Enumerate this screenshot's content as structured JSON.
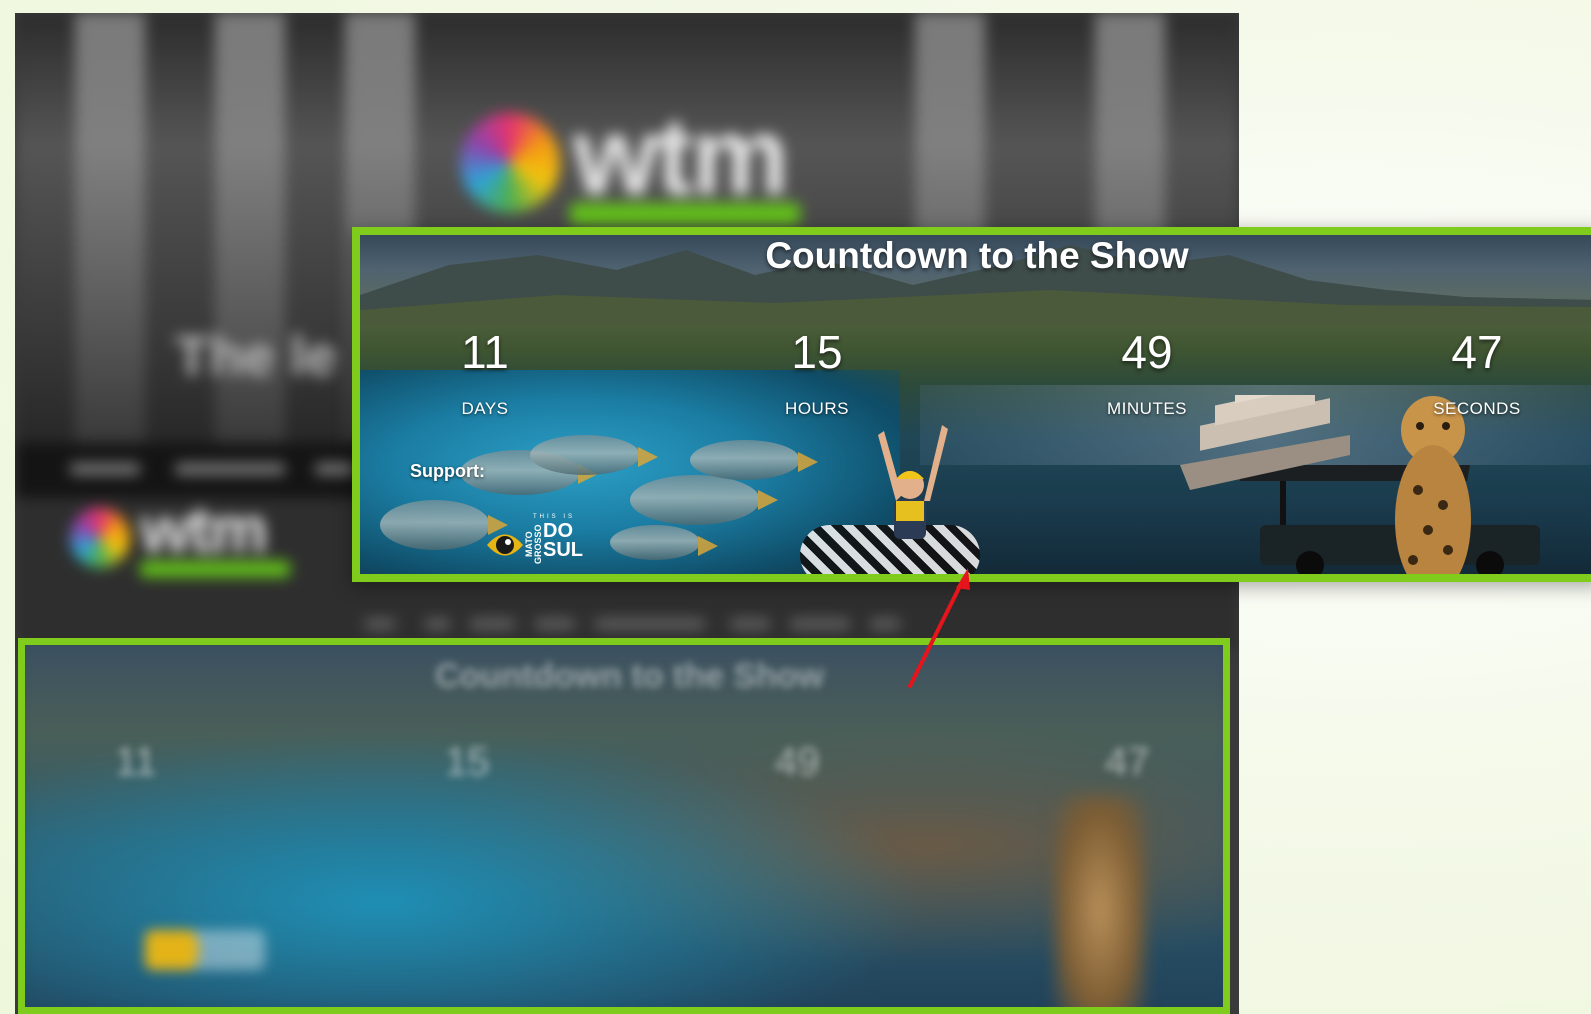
{
  "background_site": {
    "logo_text": "wtm",
    "tagline_fragment": "The le"
  },
  "countdown": {
    "title": "Countdown to the Show",
    "units": [
      {
        "value": "11",
        "label": "DAYS"
      },
      {
        "value": "15",
        "label": "HOURS"
      },
      {
        "value": "49",
        "label": "MINUTES"
      },
      {
        "value": "47",
        "label": "SECONDS"
      }
    ],
    "support_label": "Support:"
  },
  "sponsor": {
    "small_text": "THIS IS",
    "vertical_text": "MATO GROSSO",
    "main_text_line1": "DO",
    "main_text_line2": "SUL",
    "icon": "eye-icon"
  },
  "bottom_countdown": {
    "title": "Countdown to the Show",
    "values": [
      "11",
      "15",
      "49",
      "47"
    ]
  },
  "colors": {
    "highlight_border": "#80cc1c",
    "arrow": "#e8141b",
    "text": "#ffffff"
  }
}
